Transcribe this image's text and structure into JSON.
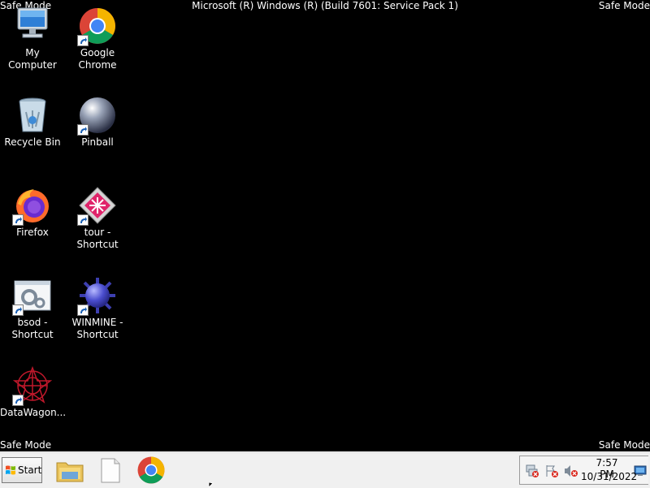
{
  "overlay": {
    "safe_mode_top_left": "Safe Mode",
    "safe_mode_top_right": "Safe Mode",
    "safe_mode_bottom_left": "Safe Mode",
    "safe_mode_bottom_right": "Safe Mode",
    "build_text": "Microsoft (R) Windows (R) (Build 7601: Service Pack 1)"
  },
  "desktop": {
    "icons": [
      {
        "label": "My Computer",
        "icon": "computer-icon"
      },
      {
        "label": "Google Chrome",
        "icon": "chrome-icon"
      },
      {
        "label": "Recycle Bin",
        "icon": "recycle-bin-icon"
      },
      {
        "label": "Pinball",
        "icon": "pinball-icon"
      },
      {
        "label": "Firefox",
        "icon": "firefox-icon"
      },
      {
        "label": "tour - Shortcut",
        "icon": "tour-icon"
      },
      {
        "label": "bsod - Shortcut",
        "icon": "bsod-icon"
      },
      {
        "label": "WINMINE - Shortcut",
        "icon": "minesweeper-icon"
      },
      {
        "label": "DataWagon...",
        "icon": "datawagon-icon"
      }
    ]
  },
  "taskbar": {
    "start_label": "Start",
    "pinned": [
      "file-explorer-icon",
      "blank-document-icon",
      "chrome-icon"
    ],
    "tray_icons": [
      "network-error-icon",
      "action-center-error-icon",
      "volume-muted-icon",
      "show-desktop-icon"
    ],
    "clock_time": "7:57 PM",
    "clock_date": "10/31/2022"
  }
}
